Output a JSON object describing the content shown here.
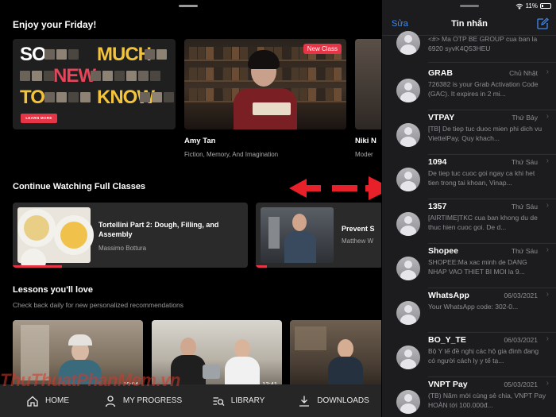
{
  "left_app": {
    "section_featured": "Enjoy your Friday!",
    "featured": {
      "words": [
        "SO",
        "MUCH",
        "NEW",
        "TO",
        "KNOW"
      ],
      "button": "LEARN MORE"
    },
    "class_cards": [
      {
        "badge": "New Class",
        "title": "Amy Tan",
        "subtitle": "Fiction, Memory, And Imagination"
      },
      {
        "title": "Niki N",
        "subtitle": "Moder"
      }
    ],
    "section_continue": "Continue Watching Full Classes",
    "continue": [
      {
        "title": "Tortellini Part 2: Dough, Filling, and Assembly",
        "instructor": "Massimo Bottura",
        "progress": 0.18
      },
      {
        "title": "Prevent S",
        "instructor": "Matthew W",
        "progress": 0.15
      }
    ],
    "section_lessons": "Lessons you'll love",
    "lessons_subtitle": "Check back daily for new personalized recommendations",
    "lessons": [
      {
        "duration": "10:04"
      },
      {
        "duration": "12:41"
      },
      {
        "duration": ""
      }
    ],
    "watermark": "ThuThuatPhanMem.vn",
    "tabs": [
      {
        "label": "HOME",
        "icon": "home-icon"
      },
      {
        "label": "MY PROGRESS",
        "icon": "person-icon"
      },
      {
        "label": "LIBRARY",
        "icon": "library-icon"
      },
      {
        "label": "DOWNLOADS",
        "icon": "download-icon"
      }
    ]
  },
  "messages_app": {
    "status": {
      "battery": "11%"
    },
    "edit": "Sửa",
    "title": "Tin nhắn",
    "items": [
      {
        "name": "",
        "time": "",
        "text": "<#> Ma OTP BE GROUP cua ban la 6920 syvK4Q53HEU"
      },
      {
        "name": "GRAB",
        "time": "Chủ Nhật",
        "text": "726382 is your Grab Activation Code (GAC). It expires in 2 mi..."
      },
      {
        "name": "VTPAY",
        "time": "Thứ Bảy",
        "text": "[TB] De tiep tuc duoc mien phi dich vu ViettelPay, Quy khach..."
      },
      {
        "name": "1094",
        "time": "Thứ Sáu",
        "text": "De tiep tuc cuoc goi ngay ca khi het tien trong tai khoan, Vinap..."
      },
      {
        "name": "1357",
        "time": "Thứ Sáu",
        "text": "[AIRTIME]TKC cua ban khong du de thuc hien cuoc goi. De d..."
      },
      {
        "name": "Shopee",
        "time": "Thứ Sáu",
        "text": "SHOPEE:Ma xac minh de DANG NHAP VAO THIET BI MOI la 9..."
      },
      {
        "name": "WhatsApp",
        "time": "06/03/2021",
        "text": "Your WhatsApp code: 302-0..."
      },
      {
        "name": "BO_Y_TE",
        "time": "06/03/2021",
        "text": "Bộ Y tế đề nghị các hộ gia đình đang có người cách ly y tế tạ..."
      },
      {
        "name": "VNPT Pay",
        "time": "05/03/2021",
        "text": "(TB) Năm mới cùng sẻ chia, VNPT Pay HOÀN tới 100.000đ..."
      }
    ]
  },
  "colors": {
    "accent_red": "#e63546",
    "ios_blue": "#3d8bf5"
  }
}
